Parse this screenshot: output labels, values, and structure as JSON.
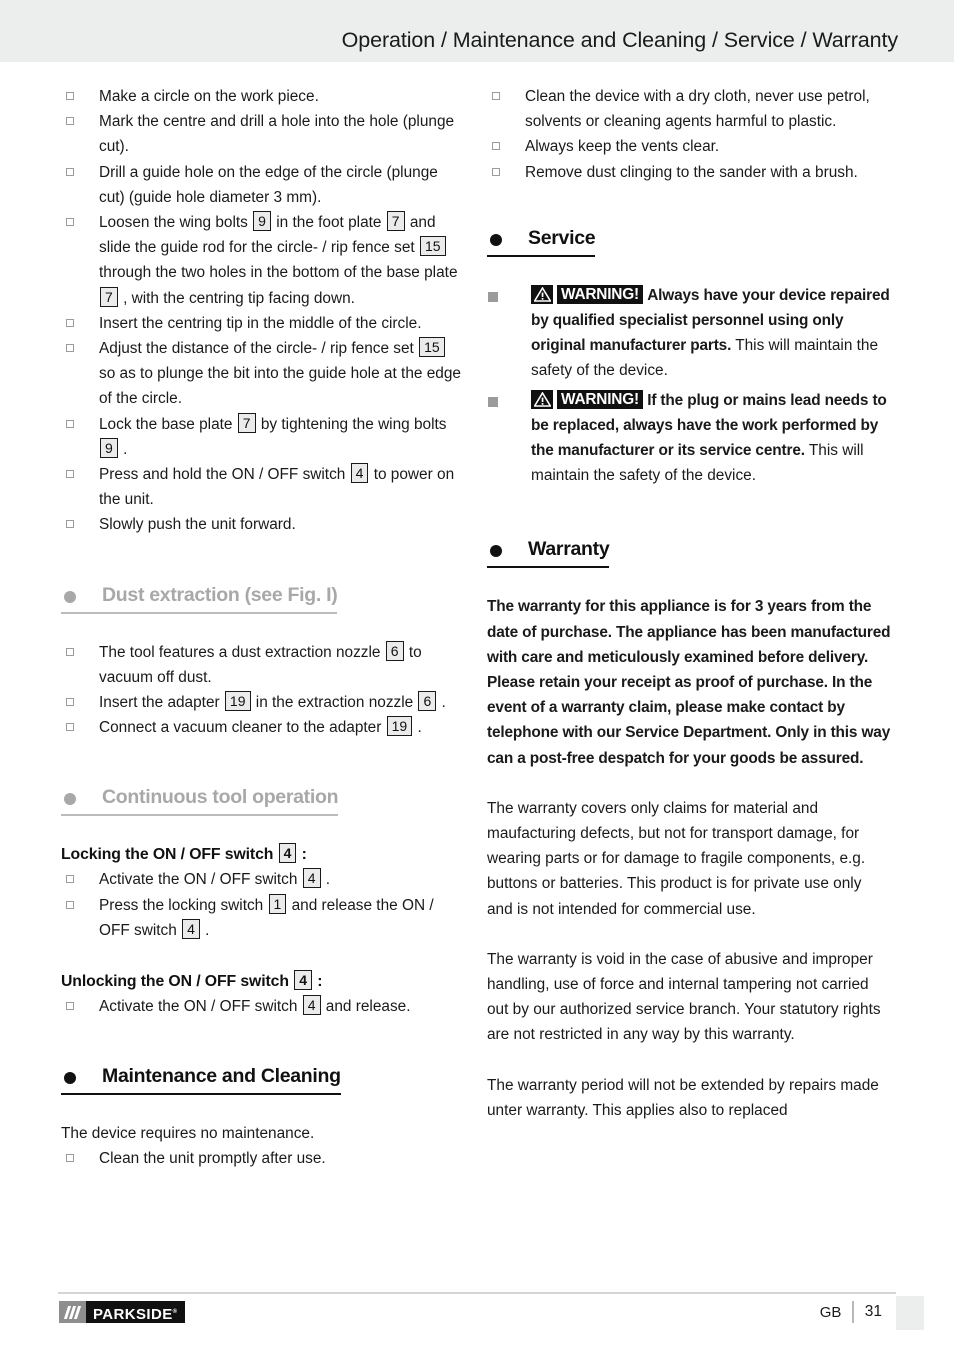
{
  "header": {
    "title": "Operation / Maintenance and Cleaning / Service / Warranty"
  },
  "left_column": {
    "circle_cut_steps": [
      "Make a circle on the work piece.",
      "Mark the centre and drill a hole into the hole (plunge cut).",
      "Drill a guide hole on the edge of the circle (plunge cut) (guide hole diameter 3 mm).",
      "Loosen the wing bolts |9| in the foot plate |7| and slide the guide rod for the circle- / rip fence set |15| through the two holes in the bottom of the base plate |7| , with the centring tip facing down.",
      "Insert the centring tip in the middle of the circle.",
      "Adjust the distance of the circle- / rip fence set |15| so as to plunge the bit into the guide hole at the edge of the circle.",
      "Lock the base plate |7| by tightening the wing bolts |9| .",
      "Press and hold the ON / OFF switch |4| to power on the unit.",
      "Slowly push the unit forward."
    ],
    "dust_extraction": {
      "heading": "Dust extraction (see Fig. I)",
      "items": [
        "The tool features a dust extraction nozzle |6| to vacuum off dust.",
        "Insert the adapter |19| in the extraction nozzle |6| .",
        "Connect a vacuum cleaner to the adapter |19| ."
      ]
    },
    "continuous_operation": {
      "heading": "Continuous tool operation",
      "locking_subhead": "Locking the ON / OFF switch |4| :",
      "locking_items": [
        "Activate the ON / OFF switch |4| .",
        "Press the locking switch |1| and release the ON / OFF switch |4| ."
      ],
      "unlocking_subhead": "Unlocking the ON / OFF switch |4| :",
      "unlocking_items": [
        "Activate the ON / OFF switch |4| and release."
      ]
    },
    "maintenance": {
      "heading": "Maintenance and Cleaning",
      "intro": "The device requires no maintenance.",
      "items": [
        "Clean the unit promptly after use."
      ]
    }
  },
  "right_column": {
    "cleaning_items": [
      "Clean the device with a dry cloth, never use petrol, solvents or cleaning agents harmful to plastic.",
      "Always keep the vents clear.",
      "Remove dust clinging to the sander with a brush."
    ],
    "service": {
      "heading": "Service",
      "warning_label": "WARNING!",
      "items": [
        {
          "bold": "Always have your device repaired by qualified specialist personnel using only original manufacturer parts.",
          "normal": " This will maintain the safety of the device."
        },
        {
          "bold": "If the plug or mains lead needs to be replaced, always have the work performed by the manufacturer or its service centre.",
          "normal": " This will maintain the safety of the device."
        }
      ]
    },
    "warranty": {
      "heading": "Warranty",
      "bold_paragraph": "The warranty for this appliance is for 3 years from the date of purchase. The appliance has been manufactured with care and meticulously examined before delivery. Please retain your receipt as proof of purchase. In the event of a warranty claim, please make contact by telephone with our Service Department. Only in this way can a post-free despatch for your goods be assured.",
      "paragraphs": [
        "The warranty covers only claims for material and maufacturing defects, but not for transport damage, for wearing parts or for damage to fragile components, e.g. buttons or batteries. This product is for private use only and is not intended for commercial use.",
        "The warranty is void in the case of abusive and improper handling, use of force and internal tampering not carried out by our authorized service branch. Your statutory rights are not restricted in any way by this warranty.",
        "The warranty period will not be extended by repairs made unter warranty. This applies also to replaced"
      ]
    }
  },
  "footer": {
    "brand": "PARKSIDE",
    "language": "GB",
    "page_number": "31"
  },
  "icons": {
    "checkbox": "empty-square-bullet",
    "filled_square": "filled-square-bullet",
    "heading_dot": "filled-circle-bullet",
    "warning_triangle": "warning-triangle-icon",
    "logo_slashes": "parkside-slashes-icon"
  },
  "colors": {
    "header_band": "#eceded",
    "gray_heading": "#a8a8a8",
    "black_heading": "#111111",
    "ref_chip_bg": "#ebebeb",
    "bullet_gray": "#9b9b9b"
  }
}
